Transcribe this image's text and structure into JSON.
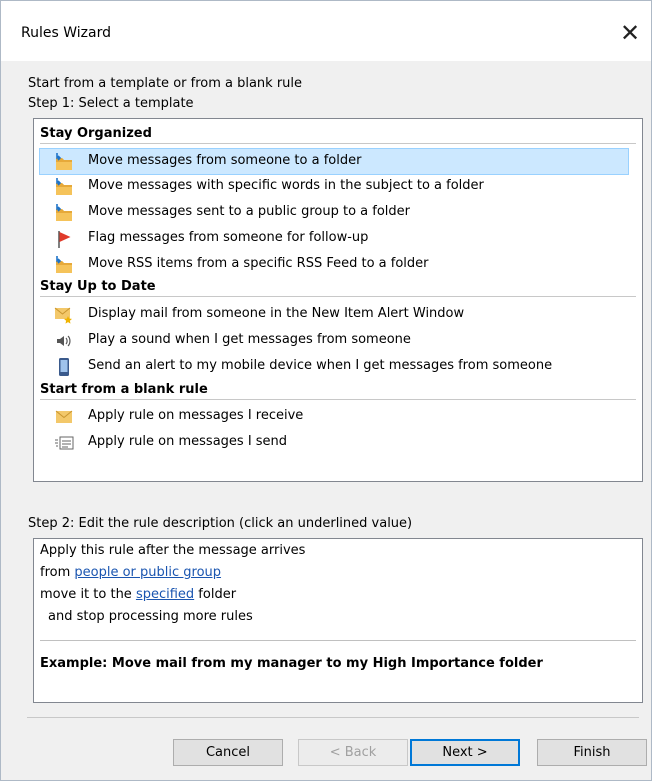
{
  "window": {
    "title": "Rules Wizard",
    "close_glyph": "✕"
  },
  "intro": "Start from a template or from a blank rule",
  "step1": "Step 1: Select a template",
  "groups": [
    {
      "label": "Stay Organized",
      "items": [
        {
          "label": "Move messages from someone to a folder",
          "icon": "folder-arrow-icon",
          "selected": true
        },
        {
          "label": "Move messages with specific words in the subject to a folder",
          "icon": "folder-arrow-icon"
        },
        {
          "label": "Move messages sent to a public group to a folder",
          "icon": "folder-arrow-icon"
        },
        {
          "label": "Flag messages from someone for follow-up",
          "icon": "red-flag-icon"
        },
        {
          "label": "Move RSS items from a specific RSS Feed to a folder",
          "icon": "folder-arrow-icon"
        }
      ]
    },
    {
      "label": "Stay Up to Date",
      "items": [
        {
          "label": "Display mail from someone in the New Item Alert Window",
          "icon": "envelope-star-icon"
        },
        {
          "label": "Play a sound when I get messages from someone",
          "icon": "speaker-icon"
        },
        {
          "label": "Send an alert to my mobile device when I get messages from someone",
          "icon": "mobile-device-icon"
        }
      ]
    },
    {
      "label": "Start from a blank rule",
      "items": [
        {
          "label": "Apply rule on messages I receive",
          "icon": "envelope-icon"
        },
        {
          "label": "Apply rule on messages I send",
          "icon": "send-message-icon"
        }
      ]
    }
  ],
  "step2": "Step 2: Edit the rule description (click an underlined value)",
  "description": {
    "line1": "Apply this rule after the message arrives",
    "line2_prefix": "from ",
    "line2_link": "people or public group",
    "line3_prefix": "move it to the ",
    "line3_link": "specified",
    "line3_suffix": " folder",
    "line4": "and stop processing more rules",
    "example": "Example: Move mail from my manager to my High Importance folder"
  },
  "buttons": {
    "cancel": "Cancel",
    "back": "< Back",
    "next": "Next >",
    "finish": "Finish"
  },
  "colors": {
    "selection": "#cce8ff",
    "link": "#1a55b0",
    "default_button_border": "#0078d7"
  }
}
